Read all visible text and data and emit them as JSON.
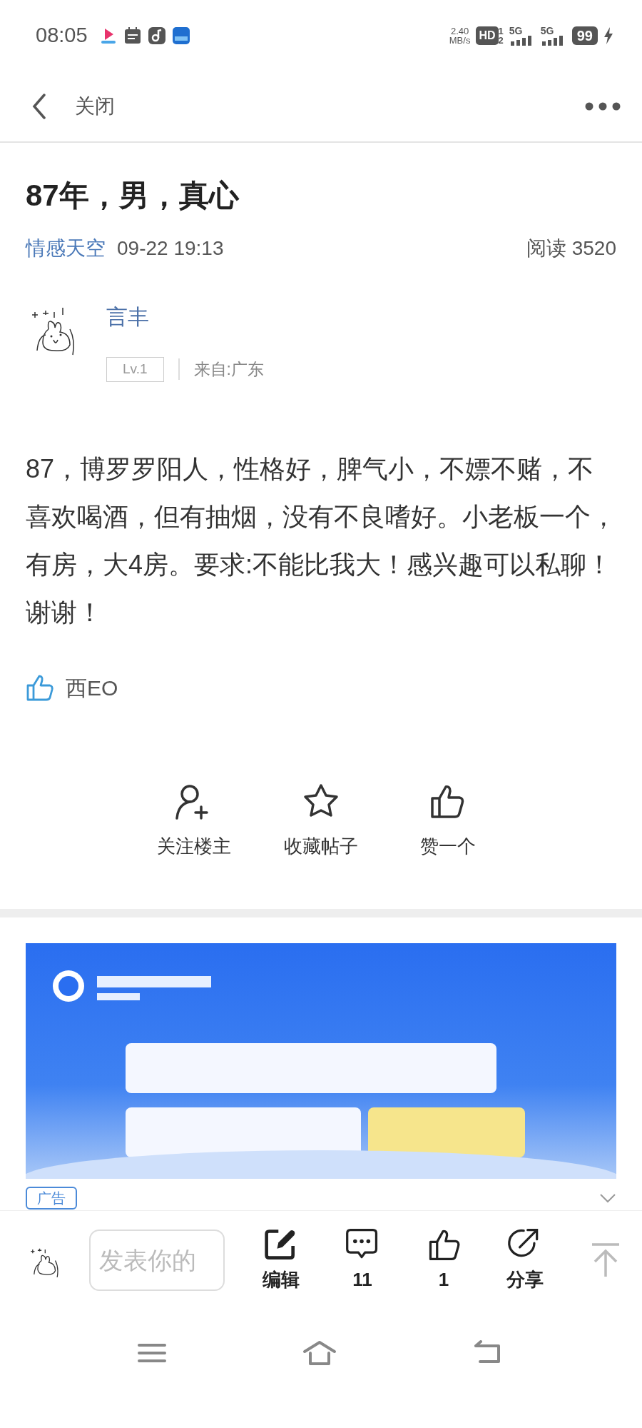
{
  "status_bar": {
    "time": "08:05",
    "net_speed": "2.40",
    "net_unit": "MB/s",
    "hd": "HD",
    "sim_slots": [
      "1",
      "2"
    ],
    "networks": [
      "5G",
      "5G"
    ],
    "battery": "99",
    "charging": true
  },
  "header": {
    "back_label": "关闭"
  },
  "post": {
    "title": "87年，男，真心",
    "forum": "情感天空",
    "time": "09-22 19:13",
    "reads": "阅读 3520",
    "author": {
      "name": "言丰",
      "level": "Lv.1",
      "location": "来自:广东"
    },
    "body": "87，博罗罗阳人，性格好，脾气小，不嫖不赌，不喜欢喝酒，但有抽烟，没有不良嗜好。小老板一个，有房，大4房。要求:不能比我大！感兴趣可以私聊！谢谢！",
    "likers": "西EO"
  },
  "actions": [
    {
      "kind": "follow",
      "label": "关注楼主"
    },
    {
      "kind": "favorite",
      "label": "收藏帖子"
    },
    {
      "kind": "like",
      "label": "赞一个"
    }
  ],
  "ad": {
    "kind": "picture",
    "tag": "广告"
  },
  "bottom_bar": {
    "placeholder": "发表你的",
    "actions": [
      {
        "kind": "edit",
        "label": "编辑"
      },
      {
        "kind": "comment",
        "label": "11"
      },
      {
        "kind": "like",
        "label": "1"
      },
      {
        "kind": "share",
        "label": "分享"
      }
    ]
  }
}
